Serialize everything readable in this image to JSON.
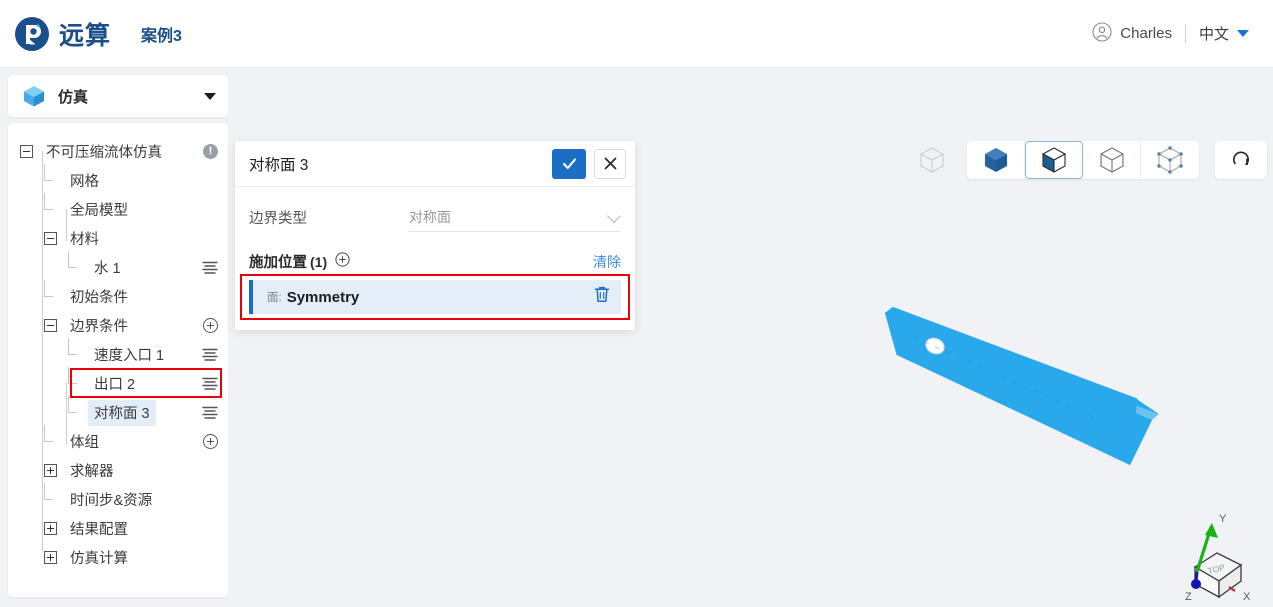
{
  "header": {
    "brand_name": "远算",
    "brand_logo_icon": "yuansuan-logo-icon",
    "case_title": "案例3",
    "user_icon": "user-avatar-icon",
    "user_name": "Charles",
    "language": "中文",
    "language_caret_icon": "caret-down-icon"
  },
  "sidebar": {
    "head": {
      "icon": "sim-cube-icon",
      "label": "仿真",
      "caret_icon": "caret-down-icon"
    },
    "tree": [
      {
        "label": "不可压缩流体仿真",
        "depth": 0,
        "toggle": "minus",
        "right_icon": "warning-icon",
        "selected": false
      },
      {
        "label": "网格",
        "depth": 1,
        "toggle": "elbow",
        "right_icon": "",
        "selected": false
      },
      {
        "label": "全局模型",
        "depth": 1,
        "toggle": "elbow",
        "right_icon": "",
        "selected": false
      },
      {
        "label": "材料",
        "depth": 1,
        "toggle": "minus",
        "right_icon": "",
        "selected": false
      },
      {
        "label": "水 1",
        "depth": 2,
        "toggle": "elbow",
        "right_icon": "lines-icon",
        "selected": false
      },
      {
        "label": "初始条件",
        "depth": 1,
        "toggle": "elbow",
        "right_icon": "",
        "selected": false
      },
      {
        "label": "边界条件",
        "depth": 1,
        "toggle": "minus",
        "right_icon": "plus-circle-icon",
        "selected": false
      },
      {
        "label": "速度入口 1",
        "depth": 2,
        "toggle": "elbow",
        "right_icon": "lines-icon",
        "selected": false
      },
      {
        "label": "出口 2",
        "depth": 2,
        "toggle": "elbow",
        "right_icon": "lines-icon",
        "selected": false
      },
      {
        "label": "对称面 3",
        "depth": 2,
        "toggle": "elbow",
        "right_icon": "lines-icon",
        "selected": true
      },
      {
        "label": "体组",
        "depth": 1,
        "toggle": "elbow",
        "right_icon": "plus-circle-icon",
        "selected": false
      },
      {
        "label": "求解器",
        "depth": 1,
        "toggle": "plus",
        "right_icon": "",
        "selected": false
      },
      {
        "label": "时间步&资源",
        "depth": 1,
        "toggle": "elbow",
        "right_icon": "",
        "selected": false
      },
      {
        "label": "结果配置",
        "depth": 1,
        "toggle": "plus",
        "right_icon": "",
        "selected": false
      },
      {
        "label": "仿真计算",
        "depth": 1,
        "toggle": "plus",
        "right_icon": "",
        "selected": false
      }
    ]
  },
  "panel": {
    "title": "对称面 3",
    "confirm_icon": "check-icon",
    "cancel_icon": "close-icon",
    "field_label": "边界类型",
    "field_value": "对称面",
    "field_caret_icon": "chevron-down-icon",
    "section_title": "施加位置",
    "section_count": "(1)",
    "section_add_icon": "plus-circle-icon",
    "section_clear_label": "清除",
    "selection": {
      "prefix": "面:",
      "name": "Symmetry",
      "delete_icon": "trash-icon"
    }
  },
  "toolbar": {
    "buttons": [
      {
        "name": "ghost-cube-button",
        "icon": "wireframe-cube-icon",
        "active": false
      },
      {
        "name": "shaded-view-button",
        "icon": "solid-cube-icon",
        "active": false
      },
      {
        "name": "shaded-edges-button",
        "icon": "solid-edges-cube-icon",
        "active": true
      },
      {
        "name": "wireframe-view-button",
        "icon": "wireframe-cube-icon",
        "active": false
      },
      {
        "name": "points-view-button",
        "icon": "points-cube-icon",
        "active": false
      },
      {
        "name": "reset-view-button",
        "icon": "reset-rotate-icon",
        "active": false
      }
    ]
  },
  "viewport": {
    "geometry_name": "plate-with-hole",
    "geometry_color": "#29a8ec",
    "background_color": "#f0f2f5",
    "axis_triad": {
      "x_label": "X",
      "y_label": "Y",
      "z_label": "Z",
      "face_label": "TOP",
      "x_color": "#cc2222",
      "y_color": "#16b416",
      "z_color": "#1414b4"
    }
  },
  "colors": {
    "accent": "#1a6fc4",
    "brand": "#1a4f8a",
    "highlight_outline": "#e8000a",
    "selection_bg": "#e4eef8"
  }
}
